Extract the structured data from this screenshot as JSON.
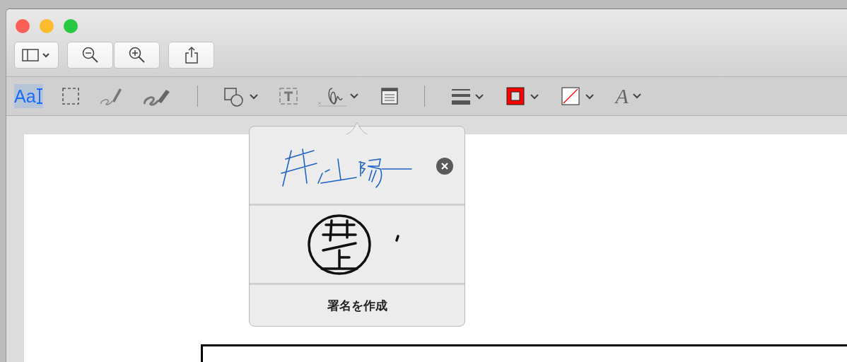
{
  "window": {
    "controls": [
      {
        "kind": "close"
      },
      {
        "kind": "minimize"
      },
      {
        "kind": "zoom"
      }
    ]
  },
  "toolbar": {
    "buttons": [
      {
        "kind": "sidebar"
      },
      {
        "kind": "zoom-out"
      },
      {
        "kind": "zoom-in"
      },
      {
        "kind": "share"
      }
    ]
  },
  "markup_tools": [
    {
      "kind": "text-select",
      "label": "Aa",
      "selected": true
    },
    {
      "kind": "rect-select",
      "selected": false
    },
    {
      "kind": "sketch",
      "selected": false
    },
    {
      "kind": "draw",
      "selected": false
    },
    {
      "kind": "separator"
    },
    {
      "kind": "shapes",
      "selected": false
    },
    {
      "kind": "text-box",
      "selected": false
    },
    {
      "kind": "sign",
      "selected": false
    },
    {
      "kind": "note",
      "selected": false
    },
    {
      "kind": "separator"
    },
    {
      "kind": "line-style",
      "selected": false
    },
    {
      "kind": "border-color",
      "color": "#ff0000",
      "selected": false
    },
    {
      "kind": "fill-color",
      "selected": false
    },
    {
      "kind": "font",
      "label": "A",
      "selected": false
    }
  ],
  "signature_popover": {
    "signatures": [
      {
        "kind": "handwritten"
      },
      {
        "kind": "seal"
      }
    ],
    "create_label": "署名を作成"
  }
}
